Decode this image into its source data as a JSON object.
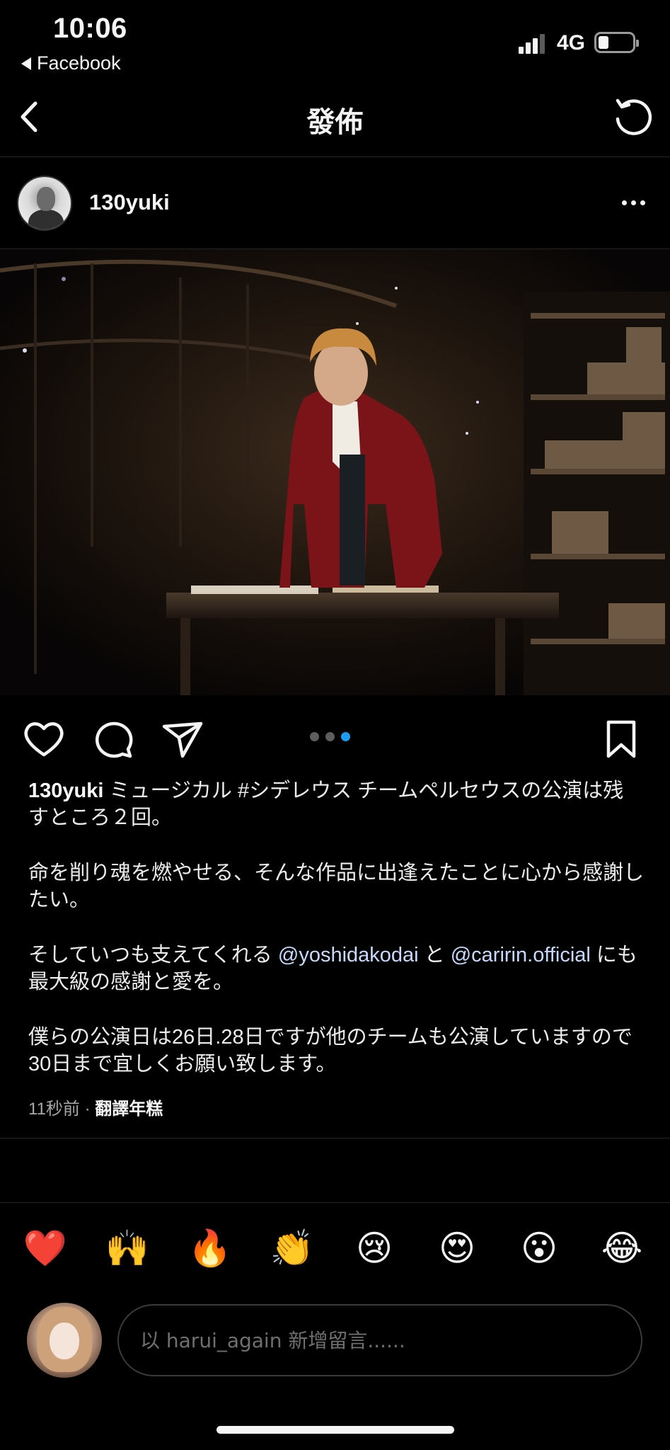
{
  "status": {
    "time": "10:06",
    "back_app": "Facebook",
    "network": "4G",
    "battery_level": 0.3
  },
  "nav": {
    "title": "發佈"
  },
  "post": {
    "username": "130yuki",
    "carousel": {
      "count": 3,
      "active_index": 2
    },
    "caption": {
      "username": "130yuki",
      "p1": "ミュージカル #シデレウス チームペルセウスの公演は残すところ２回。",
      "p2": "命を削り魂を燃やせる、そんな作品に出逢えたことに心から感謝したい。",
      "p3_prefix": "そしていつも支えてくれる ",
      "mention1": "@yoshidakodai",
      "p3_mid": " と ",
      "mention2": "@caririn.official",
      "p3_suffix": " にも最大級の感謝と愛を。",
      "p4": "僕らの公演日は26日.28日ですが他のチームも公演していますので30日まで宜しくお願い致します。"
    },
    "time_ago": "11秒前",
    "separator": " · ",
    "translate_label": "翻譯年糕"
  },
  "reactions": [
    "❤️",
    "🙌",
    "🔥",
    "👏",
    "😢",
    "😍",
    "😮",
    "😂"
  ],
  "comment": {
    "placeholder": "以 harui_again 新增留言......"
  },
  "colors": {
    "background": "#000000",
    "text": "#f5f5f5",
    "mention": "#c7d9ff",
    "active_dot": "#1d9bf0",
    "divider": "#262626"
  },
  "icons": [
    "chevron-left-icon",
    "refresh-icon",
    "more-horizontal-icon",
    "heart-icon",
    "comment-icon",
    "send-icon",
    "bookmark-icon"
  ]
}
